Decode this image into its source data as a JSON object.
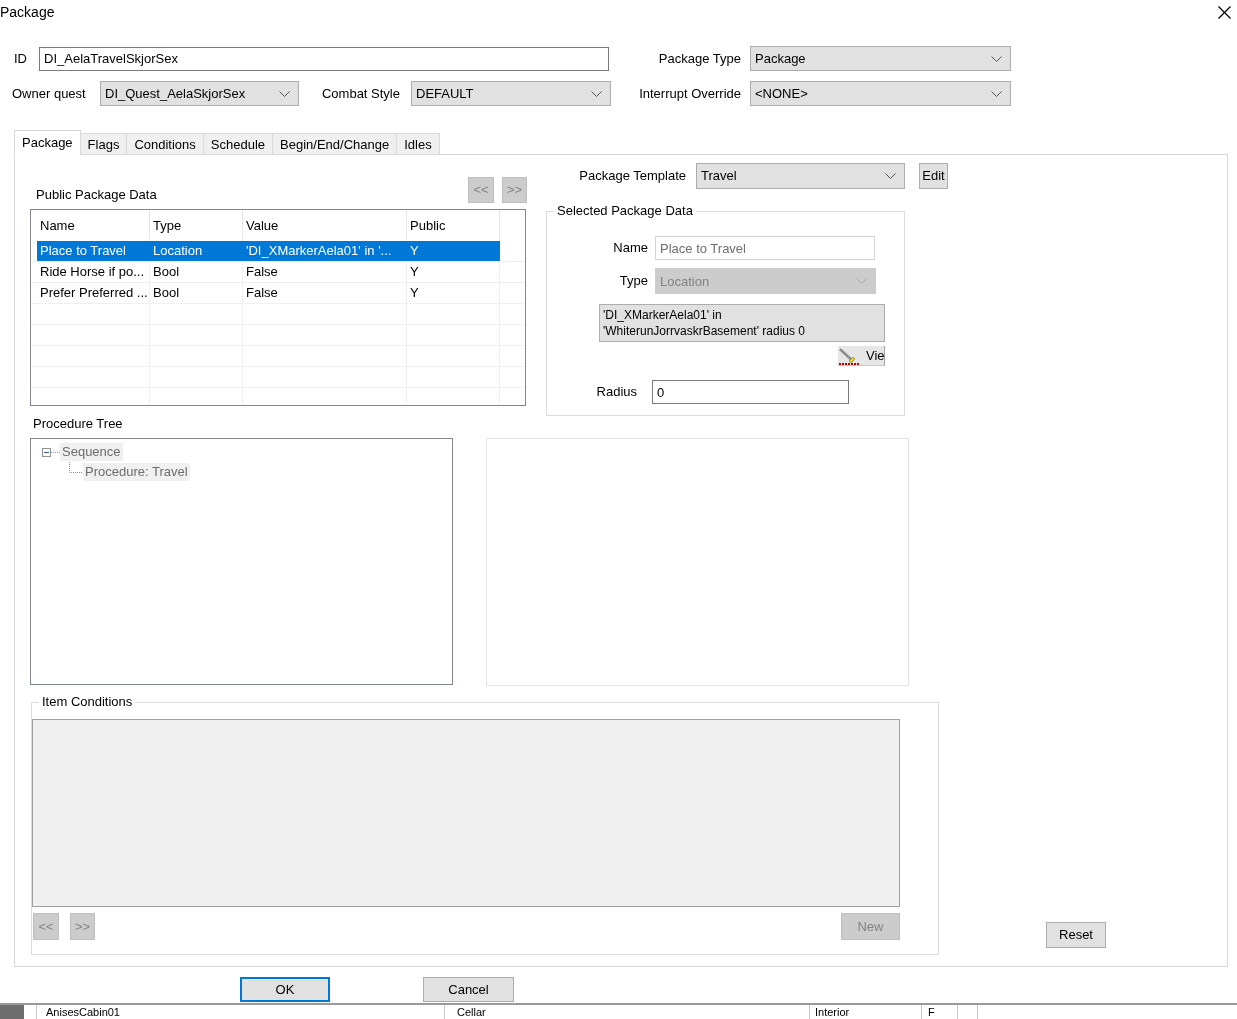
{
  "window": {
    "title": "Package"
  },
  "header": {
    "id": {
      "label": "ID",
      "value": "DI_AelaTravelSkjorSex"
    },
    "package_type": {
      "label": "Package Type",
      "value": "Package"
    },
    "owner_quest": {
      "label": "Owner quest",
      "value": "DI_Quest_AelaSkjorSex"
    },
    "combat_style": {
      "label": "Combat Style",
      "value": "DEFAULT"
    },
    "interrupt_override": {
      "label": "Interrupt Override",
      "value": "<NONE>"
    }
  },
  "tabs": [
    {
      "label": "Package",
      "selected": true
    },
    {
      "label": "Flags",
      "selected": false
    },
    {
      "label": "Conditions",
      "selected": false
    },
    {
      "label": "Schedule",
      "selected": false
    },
    {
      "label": "Begin/End/Change",
      "selected": false
    },
    {
      "label": "Idles",
      "selected": false
    }
  ],
  "public_package_data": {
    "title": "Public Package Data",
    "nav_buttons": [
      {
        "label": "<<",
        "disabled": true
      },
      {
        "label": ">>",
        "disabled": true
      }
    ],
    "columns": [
      "Name",
      "Type",
      "Value",
      "Public"
    ],
    "rows": [
      {
        "cells": [
          "Place to Travel",
          "Location",
          "'DI_XMarkerAela01' in '...",
          "Y"
        ],
        "selected": true
      },
      {
        "cells": [
          "Ride Horse if po...",
          "Bool",
          "False",
          "Y"
        ],
        "selected": false
      },
      {
        "cells": [
          "Prefer Preferred ...",
          "Bool",
          "False",
          "Y"
        ],
        "selected": false
      }
    ]
  },
  "package_template": {
    "label": "Package Template",
    "value": "Travel",
    "edit_button": "Edit"
  },
  "selected_package_data": {
    "title": "Selected Package Data",
    "name": {
      "label": "Name",
      "value": "Place to Travel",
      "disabled": true
    },
    "type": {
      "label": "Type",
      "value": "Location",
      "disabled": true
    },
    "value_text": "'DI_XMarkerAela01' in 'WhiterunJorrvaskrBasement' radius 0",
    "view_button": "Vie",
    "radius": {
      "label": "Radius",
      "value": "0"
    }
  },
  "procedure_tree": {
    "title": "Procedure Tree",
    "nodes": [
      {
        "label": "Sequence",
        "expanded": true,
        "children": [
          {
            "label": "Procedure: Travel"
          }
        ]
      }
    ]
  },
  "item_conditions": {
    "title": "Item Conditions",
    "nav_buttons": [
      {
        "label": "<<",
        "disabled": true
      },
      {
        "label": ">>",
        "disabled": true
      }
    ],
    "new_button": {
      "label": "New",
      "disabled": true
    }
  },
  "reset_button": "Reset",
  "footer_buttons": [
    {
      "label": "OK",
      "focused": true
    },
    {
      "label": "Cancel",
      "focused": false
    }
  ],
  "background_window": {
    "cells": [
      "AnisesCabin01",
      "Cellar",
      "Interior",
      "F"
    ]
  }
}
